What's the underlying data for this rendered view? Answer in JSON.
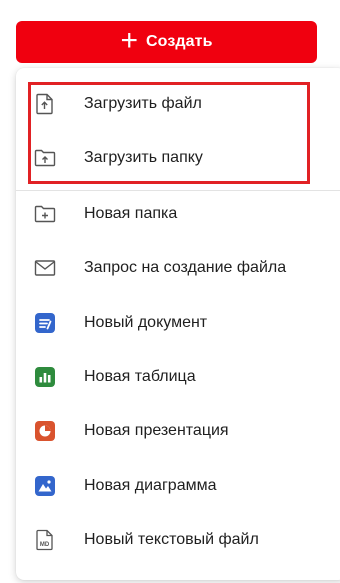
{
  "create_button": {
    "icon": "plus-icon",
    "label": "Создать",
    "color": "#f0000f"
  },
  "menu": {
    "upload_items": [
      {
        "icon": "upload-file-icon",
        "label": "Загрузить файл"
      },
      {
        "icon": "upload-folder-icon",
        "label": "Загрузить папку"
      }
    ],
    "create_items": [
      {
        "icon": "new-folder-icon",
        "label": "Новая папка"
      },
      {
        "icon": "envelope-icon",
        "label": "Запрос на создание файла"
      },
      {
        "icon": "document-app-icon",
        "label": "Новый документ",
        "color": "#3366cc"
      },
      {
        "icon": "spreadsheet-app-icon",
        "label": "Новая таблица",
        "color": "#2e8b3d"
      },
      {
        "icon": "presentation-app-icon",
        "label": "Новая презентация",
        "color": "#d9532e"
      },
      {
        "icon": "diagram-app-icon",
        "label": "Новая диаграмма",
        "color": "#3366cc"
      },
      {
        "icon": "markdown-file-icon",
        "label": "Новый текстовый файл",
        "badge": "MD"
      }
    ]
  },
  "highlight_color": "#e12124"
}
